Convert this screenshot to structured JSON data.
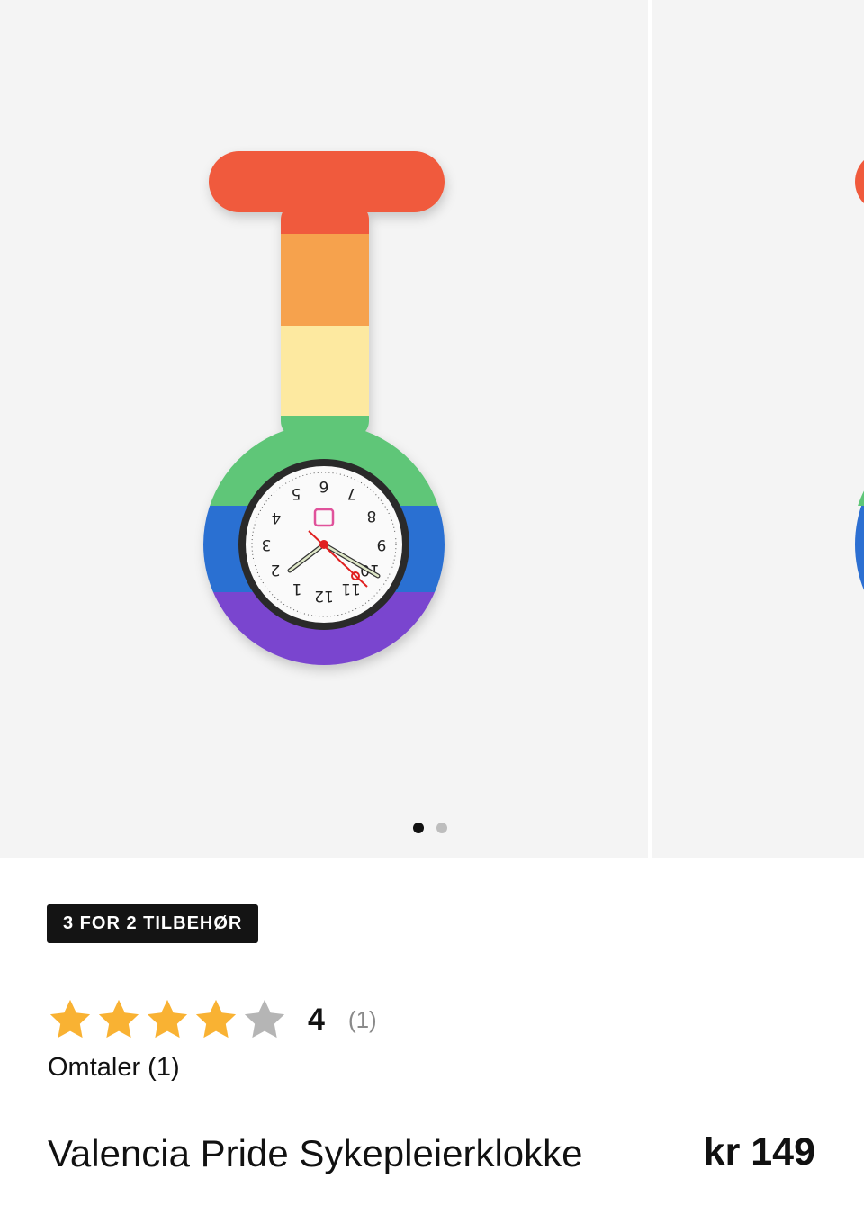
{
  "gallery": {
    "slide_count": 2,
    "active_slide": 1,
    "image_alt": "Valencia Pride Sykepleierklokke",
    "colors": {
      "background": "#f4f4f4",
      "red": "#f05a3c",
      "orange": "#f6a24e",
      "yellow": "#fde9a0",
      "green": "#5ec678",
      "blue": "#2c6fd2",
      "purple": "#7a45cf"
    }
  },
  "promo": {
    "badge": "3 FOR 2 TILBEHØR"
  },
  "rating": {
    "value": "4",
    "count": "(1)",
    "stars_filled": 4,
    "stars_total": 5,
    "star_color": "#f9b233",
    "star_empty_color": "#b5b5b5"
  },
  "reviews": {
    "link_label": "Omtaler (1)"
  },
  "product": {
    "title": "Valencia Pride Sykepleierklokke",
    "price": "kr 149"
  }
}
